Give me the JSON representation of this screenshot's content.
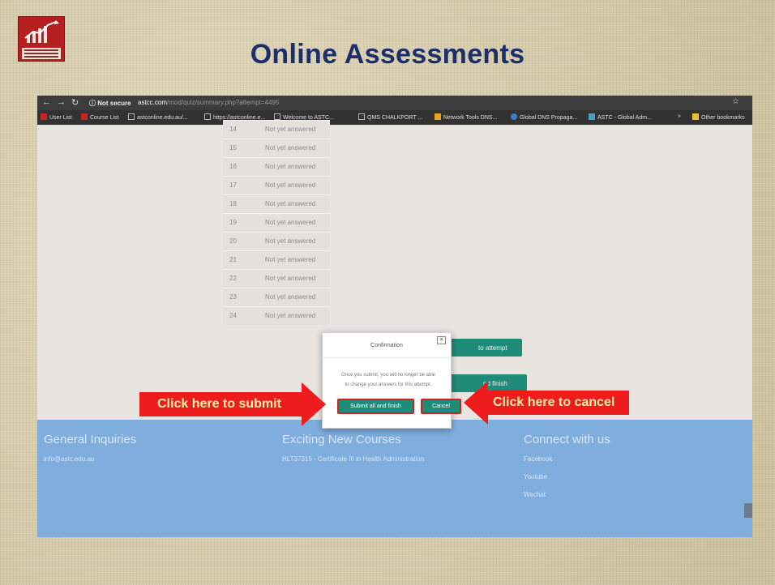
{
  "slide": {
    "title": "Online Assessments"
  },
  "browser": {
    "security_label": "ⓘ Not secure",
    "url_host": "astcc.com",
    "url_path": "/mod/quiz/summary.php?attempt=4495",
    "bookmarks": [
      "User List",
      "Course List",
      "astconline.edu.au/...",
      "https://astconline.e...",
      "Welcome to ASTC...",
      "QMS CHALKPORT ...",
      "Network Tools DNS...",
      "Global DNS Propaga...",
      "ASTC - Global Adm...",
      "»",
      "Other bookmarks"
    ]
  },
  "summary": {
    "rows": [
      {
        "num": "14",
        "status": "Not yet answered"
      },
      {
        "num": "15",
        "status": "Not yet answered"
      },
      {
        "num": "16",
        "status": "Not yet answered"
      },
      {
        "num": "17",
        "status": "Not yet answered"
      },
      {
        "num": "18",
        "status": "Not yet answered"
      },
      {
        "num": "19",
        "status": "Not yet answered"
      },
      {
        "num": "20",
        "status": "Not yet answered"
      },
      {
        "num": "21",
        "status": "Not yet answered"
      },
      {
        "num": "22",
        "status": "Not yet answered"
      },
      {
        "num": "23",
        "status": "Not yet answered"
      },
      {
        "num": "24",
        "status": "Not yet answered"
      }
    ],
    "return_button_partial": "to attempt",
    "submit_button_partial": "nd finish"
  },
  "footer": {
    "col1_heading": "General Inquiries",
    "col1_email": "info@astc.edu.au",
    "col2_heading": "Exciting New Courses",
    "col2_course": "HLT37315 - Certificate III in Health Administration",
    "col3_heading": "Connect with us",
    "col3_links": [
      "Facebook",
      "Youtube",
      "Wechat"
    ]
  },
  "dialog": {
    "title": "Confirmation",
    "close": "×",
    "message_line1": "Once you submit, you will no longer be able",
    "message_line2": "to change your answers for this attempt.",
    "submit_label": "Submit all and finish",
    "cancel_label": "Cancel"
  },
  "callouts": {
    "submit": "Click here to submit",
    "cancel": "Click here to cancel"
  },
  "colors": {
    "accent_teal": "#1f8b79",
    "callout_red": "#ee1c1c",
    "footer_blue": "#7faede",
    "title_navy": "#1c2f6b"
  }
}
